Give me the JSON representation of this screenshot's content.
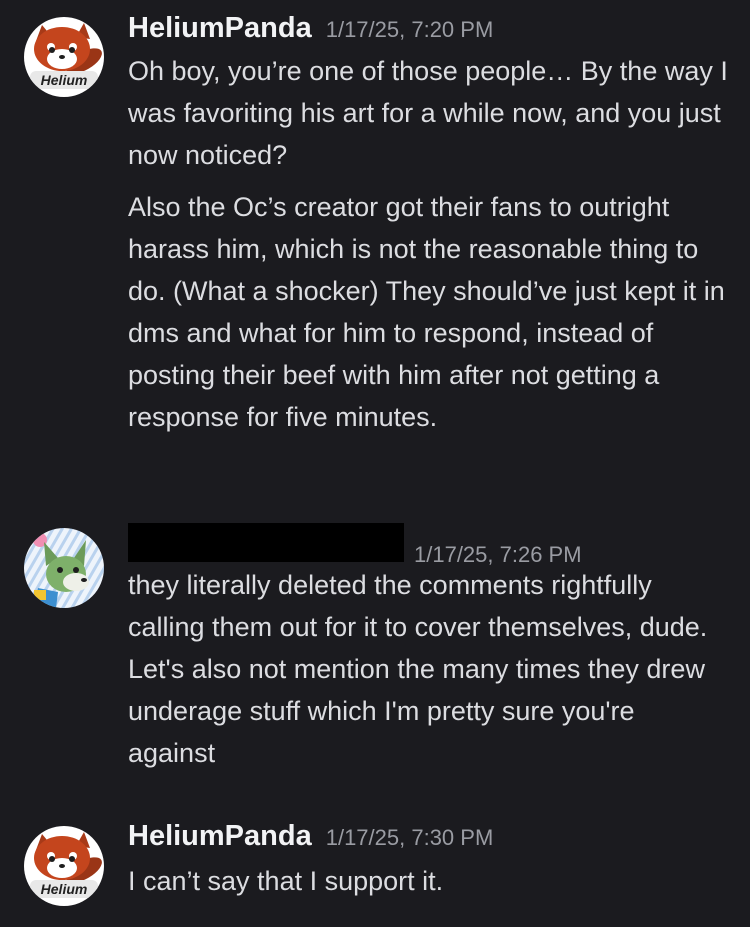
{
  "messages": [
    {
      "author": "HeliumPanda",
      "avatar_label": "Helium",
      "timestamp": "1/17/25, 7:20 PM",
      "paragraphs": [
        "Oh boy, you’re one of those people… By the way I was favoriting his art for a while now, and you just now noticed?",
        "Also the Oc’s creator got their fans to outright harass him, which is not the reasonable thing to do. (What a shocker) They should’ve just kept it in dms and what for him to respond, instead of posting their beef with him after not getting a response for five minutes."
      ]
    },
    {
      "author": "",
      "author_redacted": true,
      "timestamp": "1/17/25, 7:26 PM",
      "paragraphs": [
        "they literally deleted the comments rightfully calling them out for it to cover themselves, dude. Let's also not mention the many times they drew underage stuff which I'm pretty sure you're against"
      ]
    },
    {
      "author": "HeliumPanda",
      "avatar_label": "Helium",
      "timestamp": "1/17/25, 7:30 PM",
      "paragraphs": [
        "I can’t say that I support it."
      ]
    }
  ],
  "colors": {
    "background": "#1b1b1f",
    "username": "#f2f3f5",
    "timestamp": "#9a9ca3",
    "message_text": "#dcdde1",
    "redaction": "#000000"
  },
  "icons": {
    "helium_avatar": "red-panda-avatar-icon",
    "second_avatar": "green-fox-avatar-icon"
  }
}
